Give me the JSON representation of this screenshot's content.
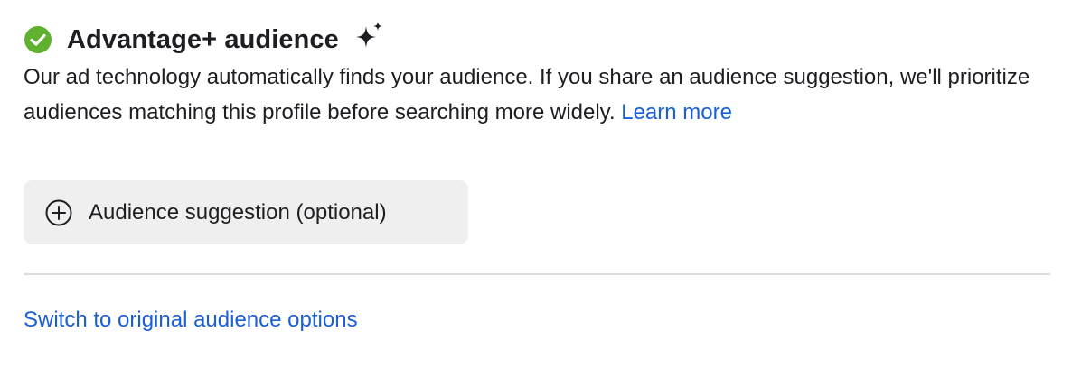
{
  "header": {
    "title": "Advantage+ audience",
    "check_icon": "check-circle-icon",
    "sparkle_icon": "sparkle-icon",
    "check_color": "#5fb12f"
  },
  "description": {
    "text": "Our ad technology automatically finds your audience. If you share an audience suggestion, we'll prioritize audiences matching this profile before searching more widely.",
    "link_label": "Learn more",
    "link_color": "#1a5fd6"
  },
  "suggestion_button": {
    "label": "Audience suggestion (optional)",
    "icon": "plus-circle-icon"
  },
  "footer": {
    "switch_link_label": "Switch to original audience options"
  }
}
